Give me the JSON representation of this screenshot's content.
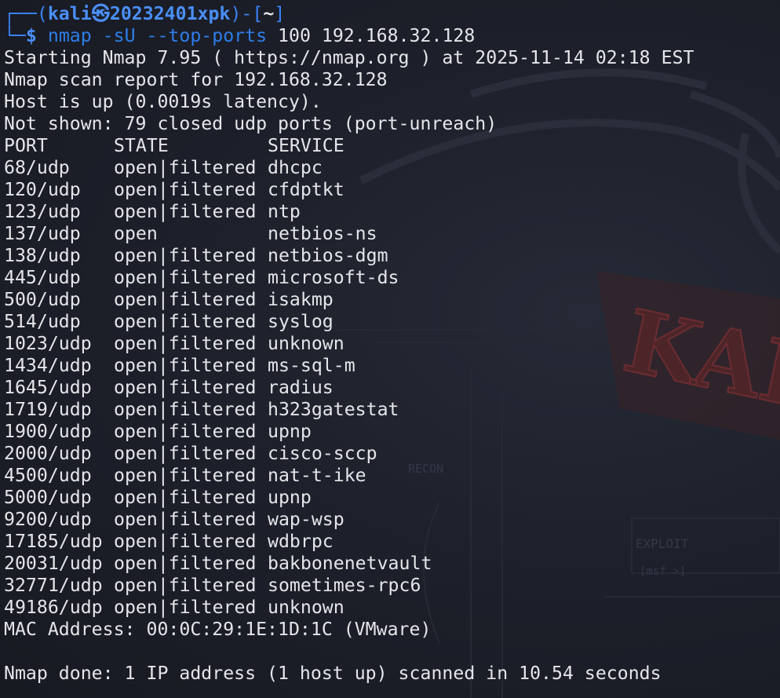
{
  "prompt": {
    "frame_left": "┌──(",
    "user": "kali",
    "at_symbol": "㉿",
    "host": "20232401xpk",
    "frame_mid": ")-[",
    "dir": "~",
    "frame_right": "]",
    "frame_bottom": "└─",
    "dollar": "$"
  },
  "command": {
    "name": "nmap",
    "args": " -sU --top-ports",
    "rest": " 100 192.168.32.128"
  },
  "output_head": [
    "Starting Nmap 7.95 ( https://nmap.org ) at 2025-11-14 02:18 EST",
    "Nmap scan report for 192.168.32.128",
    "Host is up (0.0019s latency).",
    "Not shown: 79 closed udp ports (port-unreach)"
  ],
  "table_header": {
    "port": "PORT",
    "state": "STATE",
    "service": "SERVICE"
  },
  "ports": [
    {
      "port": "68/udp",
      "state": "open|filtered",
      "service": "dhcpc"
    },
    {
      "port": "120/udp",
      "state": "open|filtered",
      "service": "cfdptkt"
    },
    {
      "port": "123/udp",
      "state": "open|filtered",
      "service": "ntp"
    },
    {
      "port": "137/udp",
      "state": "open",
      "service": "netbios-ns"
    },
    {
      "port": "138/udp",
      "state": "open|filtered",
      "service": "netbios-dgm"
    },
    {
      "port": "445/udp",
      "state": "open|filtered",
      "service": "microsoft-ds"
    },
    {
      "port": "500/udp",
      "state": "open|filtered",
      "service": "isakmp"
    },
    {
      "port": "514/udp",
      "state": "open|filtered",
      "service": "syslog"
    },
    {
      "port": "1023/udp",
      "state": "open|filtered",
      "service": "unknown"
    },
    {
      "port": "1434/udp",
      "state": "open|filtered",
      "service": "ms-sql-m"
    },
    {
      "port": "1645/udp",
      "state": "open|filtered",
      "service": "radius"
    },
    {
      "port": "1719/udp",
      "state": "open|filtered",
      "service": "h323gatestat"
    },
    {
      "port": "1900/udp",
      "state": "open|filtered",
      "service": "upnp"
    },
    {
      "port": "2000/udp",
      "state": "open|filtered",
      "service": "cisco-sccp"
    },
    {
      "port": "4500/udp",
      "state": "open|filtered",
      "service": "nat-t-ike"
    },
    {
      "port": "5000/udp",
      "state": "open|filtered",
      "service": "upnp"
    },
    {
      "port": "9200/udp",
      "state": "open|filtered",
      "service": "wap-wsp"
    },
    {
      "port": "17185/udp",
      "state": "open|filtered",
      "service": "wdbrpc"
    },
    {
      "port": "20031/udp",
      "state": "open|filtered",
      "service": "bakbonenetvault"
    },
    {
      "port": "32771/udp",
      "state": "open|filtered",
      "service": "sometimes-rpc6"
    },
    {
      "port": "49186/udp",
      "state": "open|filtered",
      "service": "unknown"
    }
  ],
  "mac_line": "MAC Address: 00:0C:29:1E:1D:1C (VMware)",
  "done_line": "Nmap done: 1 IP address (1 host up) scanned in 10.54 seconds",
  "wallpaper": {
    "logo_text": "KALI",
    "recon_label": "RECON",
    "exploit_label": "EXPLOIT",
    "msf_label": "[msf >]"
  },
  "colors": {
    "background": "#1b1e28",
    "text": "#e4e6ea",
    "prompt_blue": "#3b82f6",
    "logo_red": "#5a2a2e"
  }
}
